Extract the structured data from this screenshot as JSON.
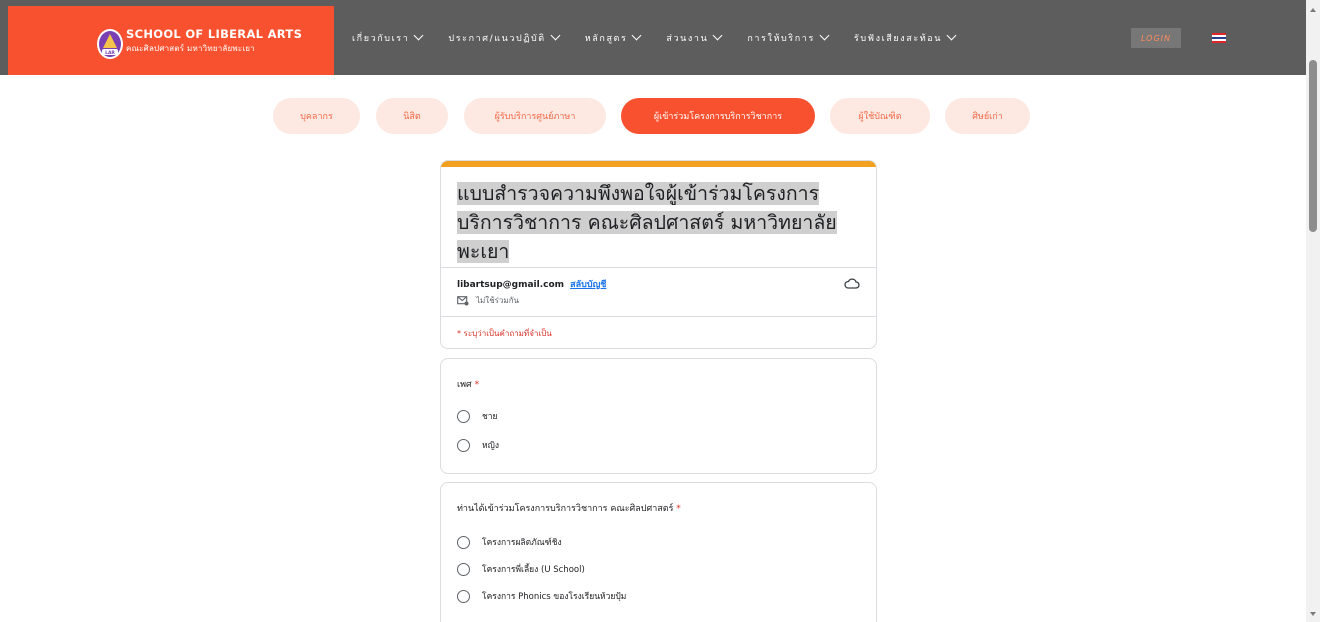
{
  "brand": {
    "title": "SCHOOL OF LIBERAL ARTS",
    "subtitle": "คณะศิลปศาสตร์ มหาวิทยาลัยพะเยา",
    "logo_icon": "university-crest-icon"
  },
  "nav": {
    "items": [
      {
        "label": "เกี่ยวกับเรา"
      },
      {
        "label": "ประกาศ/แนวปฏิบัติ"
      },
      {
        "label": "หลักสูตร"
      },
      {
        "label": "ส่วนงาน"
      },
      {
        "label": "การให้บริการ"
      },
      {
        "label": "รับฟังเสียงสะท้อน"
      }
    ],
    "login_label": "LOGIN",
    "language_icon": "thai-flag-icon"
  },
  "tabs": [
    {
      "label": "บุคลากร",
      "active": false
    },
    {
      "label": "นิสิต",
      "active": false
    },
    {
      "label": "ผู้รับบริการศูนย์ภาษา",
      "active": false
    },
    {
      "label": "ผู้เข้าร่วมโครงการบริการวิชาการ",
      "active": true
    },
    {
      "label": "ผู้ใช้บัณฑิต",
      "active": false
    },
    {
      "label": "ศิษย์เก่า",
      "active": false
    }
  ],
  "form": {
    "title_line1": "แบบสำรวจความพึงพอใจผู้เข้าร่วมโครงการ",
    "title_line2": "บริการวิชาการ คณะศิลปศาสตร์ มหาวิทยาลัย",
    "title_line3": "พะเยา",
    "email": "libartsup@gmail.com",
    "switch_account": "สลับบัญชี",
    "not_shared": "ไม่ใช้ร่วมกัน",
    "required_note": "* ระบุว่าเป็นคำถามที่จำเป็น"
  },
  "questions": [
    {
      "title": "เพศ",
      "required_mark": "*",
      "options": [
        "ชาย",
        "หญิง"
      ]
    },
    {
      "title": "ท่านได้เข้าร่วมโครงการบริการวิชาการ คณะศิลปศาสตร์",
      "required_mark": "*",
      "options": [
        "โครงการผลิตภัณฑ์ชิง",
        "โครงการพี่เลี้ยง (U School)",
        "โครงการ Phonics ของโรงเรียนห้วยปุ้ม"
      ]
    }
  ],
  "colors": {
    "brand_orange": "#f8512f",
    "header_gray": "#5d5d5d",
    "form_accent": "#f2a01f",
    "required_red": "#d93025",
    "link_blue": "#1a73e8"
  }
}
